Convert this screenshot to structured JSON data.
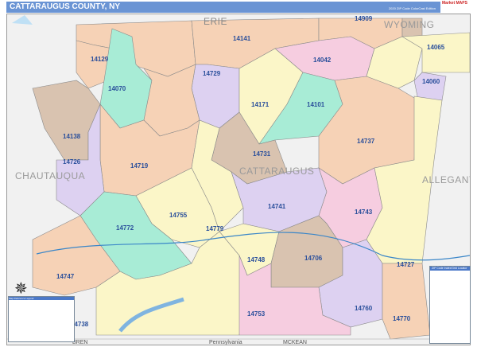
{
  "header": {
    "title": "CATTARAUGUS COUNTY, NY",
    "edition": "2020 ZIP Code ColorCast Edition",
    "logo": "Market MAPS"
  },
  "counties": [
    "ERIE",
    "WYOMING",
    "CHAUTAUQUA",
    "CATTARAUGUS",
    "ALLEGANY",
    "MCKEAN"
  ],
  "state_labels": [
    "Pennsylvania",
    "BREN"
  ],
  "zip_codes": [
    "14909",
    "14141",
    "14129",
    "14042",
    "14065",
    "14070",
    "14729",
    "14060",
    "14171",
    "14101",
    "14138",
    "14737",
    "14731",
    "14726",
    "14719",
    "14741",
    "14755",
    "14743",
    "14779",
    "14772",
    "14748",
    "14706",
    "14727",
    "14747",
    "14760",
    "14753",
    "14770",
    "14738"
  ],
  "legend": {
    "title": "Map Reference Legend"
  },
  "locator": {
    "title": "ZIP Code Index/Grid Locator"
  },
  "colors": {
    "title_bar": "#6a94d4",
    "zip_label": "#2a4f9b",
    "orange": "#f6d2b6",
    "purple": "#ddd1f1",
    "green": "#a8ecd6",
    "tan": "#d9c3b0",
    "yellow": "#fbf6c8",
    "pink": "#f6cde0"
  }
}
